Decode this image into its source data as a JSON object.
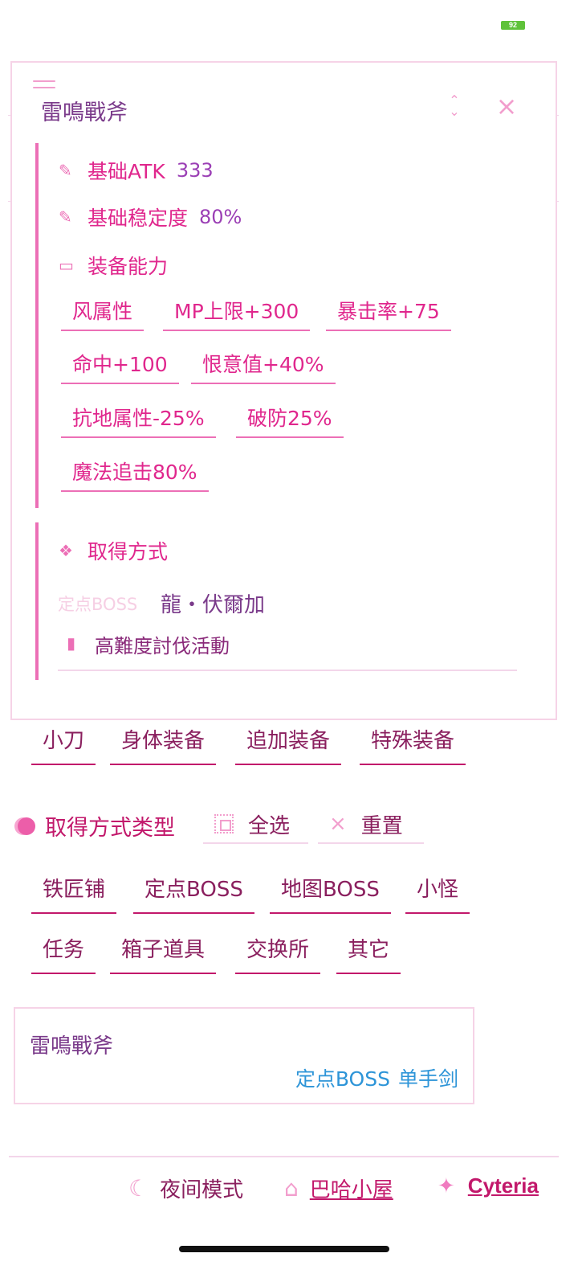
{
  "status_bar": {
    "battery": "92"
  },
  "modal": {
    "title": "雷鳴戰斧",
    "stats": [
      {
        "label": "基础ATK",
        "value": "333"
      },
      {
        "label": "基础稳定度",
        "value": "80%"
      }
    ],
    "abilities_title": "装备能力",
    "abilities": [
      "风属性",
      "MP上限+300",
      "暴击率+75",
      "命中+100",
      "恨意值+40%",
      "抗地属性-25%",
      "破防25%",
      "魔法追击80%"
    ],
    "acquire_title": "取得方式",
    "acquire_type": "定点BOSS",
    "acquire_boss": "龍・伏爾加",
    "acquire_place": "高難度討伐活動"
  },
  "categories": [
    "小刀",
    "身体装备",
    "追加装备",
    "特殊装备"
  ],
  "type_filter": {
    "title": "取得方式类型",
    "select_all": "全选",
    "reset": "重置",
    "types": [
      "铁匠铺",
      "定点BOSS",
      "地图BOSS",
      "小怪",
      "任务",
      "箱子道具",
      "交换所",
      "其它"
    ]
  },
  "result_card": {
    "title": "雷鳴戰斧",
    "acquire": "定点BOSS",
    "weapon_type": "单手剑"
  },
  "footer": {
    "night_mode": "夜间模式",
    "home_link": "巴哈小屋",
    "twitter_link": "Cyteria"
  },
  "colors": {
    "accent": "#e0278d",
    "dark_accent": "#c2186b",
    "light_accent": "#f29ecd",
    "value_purple": "#9b3fb5",
    "link_blue": "#2e95d8"
  }
}
